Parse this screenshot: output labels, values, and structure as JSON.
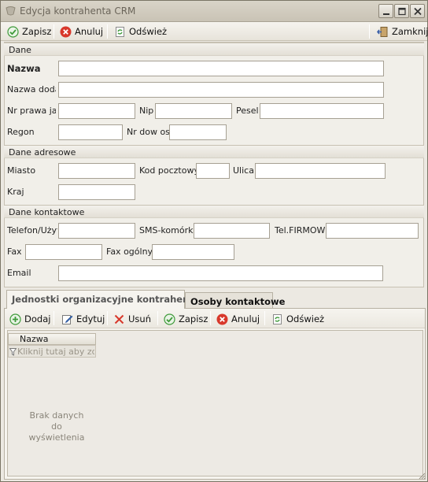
{
  "window": {
    "title": "Edycja kontrahenta CRM",
    "minimize_icon": "minimize-icon",
    "maximize_icon": "maximize-icon",
    "close_icon": "close-icon"
  },
  "toolbar": {
    "save_label": "Zapisz",
    "cancel_label": "Anuluj",
    "refresh_label": "Odśwież",
    "close_label": "Zamknij"
  },
  "section_dane": {
    "title": "Dane",
    "nazwa_label": "Nazwa",
    "nazwa_value": "",
    "nazwa_dodatkowa_label": "Nazwa dodat",
    "nr_prawa_jazdy_label": "Nr prawa jaz",
    "nip_label": "Nip",
    "pesel_label": "Pesel",
    "regon_label": "Regon",
    "nr_dow_os_label": "Nr dow os"
  },
  "section_adres": {
    "title": "Dane adresowe",
    "miasto_label": "Miasto",
    "kod_pocztowy_label": "Kod pocztowy",
    "ulica_label": "Ulica",
    "kraj_label": "Kraj"
  },
  "section_kontakt": {
    "title": "Dane kontaktowe",
    "telefon_label": "Telefon/Użyt",
    "sms_label": "SMS-komórka",
    "tel_firmowy_label": "Tel.FIRMOW",
    "fax_label": "Fax",
    "fax_ogolny_label": "Fax ogólny",
    "email_label": "Email"
  },
  "tabs": [
    {
      "label": "Jednostki organizacyjne kontrahenta",
      "active": true
    },
    {
      "label": "Osoby kontaktowe",
      "active": false
    }
  ],
  "subtoolbar": {
    "add_label": "Dodaj",
    "edit_label": "Edytuj",
    "delete_label": "Usuń",
    "save_label": "Zapisz",
    "cancel_label": "Anuluj",
    "refresh_label": "Odśwież"
  },
  "grid": {
    "column_header": "Nazwa",
    "filter_placeholder": "Kliknij tutaj aby zdefiniować filtr",
    "empty_text": "Brak danych do wyświetlenia"
  },
  "colors": {
    "accent_green": "#3f9a3a",
    "cancel_red": "#d8382b",
    "background": "#ece9e2"
  }
}
